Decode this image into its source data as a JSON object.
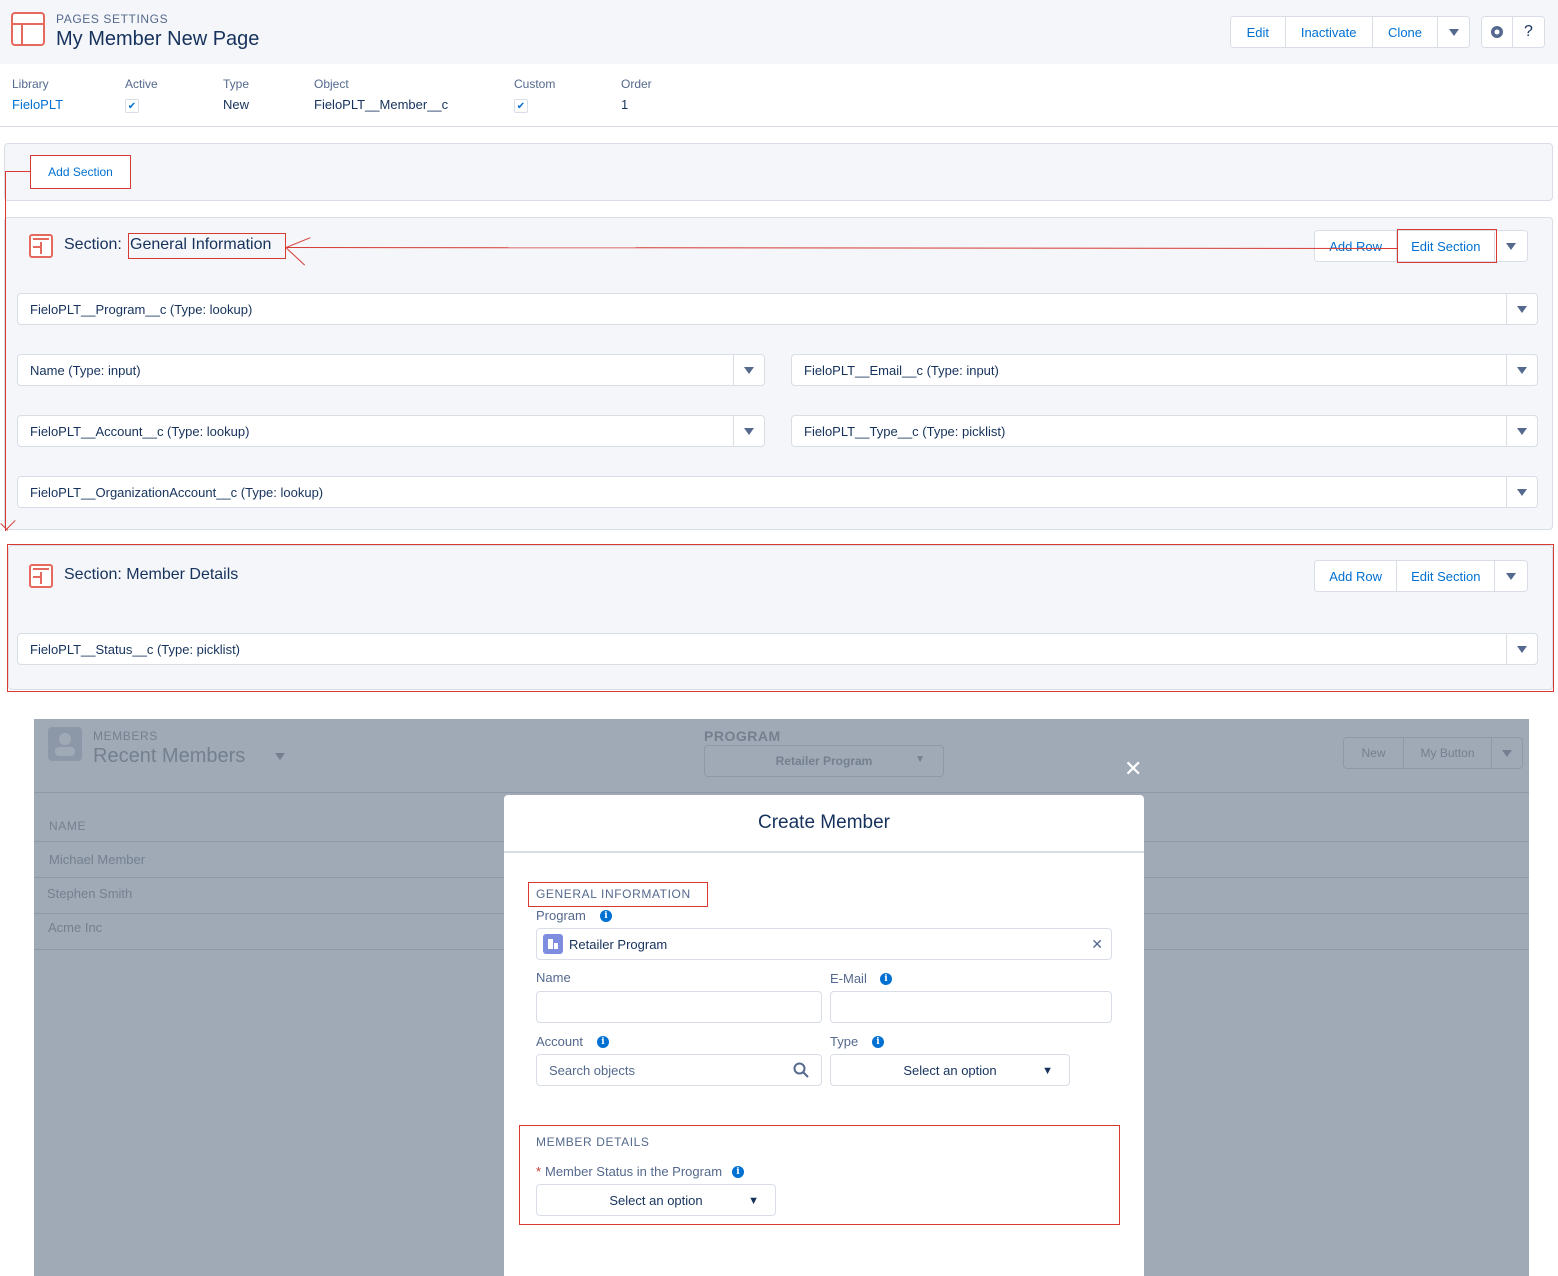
{
  "header": {
    "eyebrow": "PAGES SETTINGS",
    "title": "My Member New Page",
    "actions": [
      "Edit",
      "Inactivate",
      "Clone"
    ],
    "help_icon": "?"
  },
  "highlights": {
    "library_label": "Library",
    "library_value": "FieloPLT",
    "active_label": "Active",
    "active_checked": true,
    "type_label": "Type",
    "type_value": "New",
    "object_label": "Object",
    "object_value": "FieloPLT__Member__c",
    "custom_label": "Custom",
    "custom_checked": true,
    "order_label": "Order",
    "order_value": "1"
  },
  "add_section_label": "Add Section",
  "sections": [
    {
      "prefix": "Section:",
      "name": "General Information",
      "add_row": "Add Row",
      "edit_section": "Edit Section",
      "fields": {
        "program": "FieloPLT__Program__c (Type: lookup)",
        "name": "Name (Type: input)",
        "email": "FieloPLT__Email__c (Type: input)",
        "account": "FieloPLT__Account__c (Type: lookup)",
        "type": "FieloPLT__Type__c (Type: picklist)",
        "org_account": "FieloPLT__OrganizationAccount__c (Type: lookup)"
      }
    },
    {
      "title": "Section: Member Details",
      "add_row": "Add Row",
      "edit_section": "Edit Section",
      "fields": {
        "status": "FieloPLT__Status__c (Type: picklist)"
      }
    }
  ],
  "background_app": {
    "eyebrow": "MEMBERS",
    "title": "Recent Members",
    "program_label": "PROGRAM",
    "program_value": "Retailer Program",
    "buttons": [
      "New",
      "My Button"
    ],
    "column_header": "NAME",
    "rows": [
      "Michael Member",
      "Stephen Smith",
      "Acme Inc"
    ]
  },
  "modal": {
    "close_glyph": "✕",
    "title": "Create Member",
    "general_heading": "GENERAL INFORMATION",
    "program_label": "Program",
    "program_value": "Retailer Program",
    "name_label": "Name",
    "email_label": "E-Mail",
    "account_label": "Account",
    "account_placeholder": "Search objects",
    "type_label": "Type",
    "type_placeholder": "Select an option",
    "details_heading": "MEMBER DETAILS",
    "status_required": "*",
    "status_label": "Member Status in the Program",
    "status_placeholder": "Select an option"
  },
  "colors": {
    "accent": "#0070d2",
    "brand_icon": "#e4695e",
    "annotation": "#d63a32",
    "overlay": "#a0aab7"
  }
}
